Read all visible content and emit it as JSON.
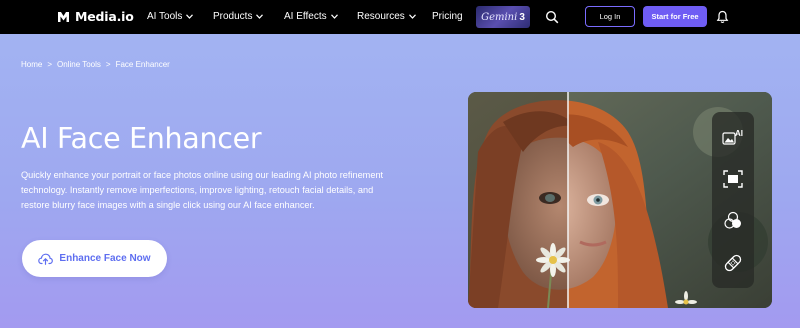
{
  "nav": {
    "brand": "Media.io",
    "items": [
      {
        "label": "AI Tools",
        "has_chevron": true
      },
      {
        "label": "Products",
        "has_chevron": true
      },
      {
        "label": "AI Effects",
        "has_chevron": true
      },
      {
        "label": "Resources",
        "has_chevron": true
      },
      {
        "label": "Pricing",
        "has_chevron": false
      }
    ],
    "promo": {
      "word": "Gemini",
      "number": "3"
    },
    "login_label": "Log In",
    "start_label": "Start for Free",
    "icons": [
      "search-icon",
      "bell-icon",
      "chevron-down-icon"
    ]
  },
  "breadcrumb": {
    "items": [
      "Home",
      "Online Tools",
      "Face Enhancer"
    ],
    "separator": ">"
  },
  "hero": {
    "title": "AI Face Enhancer",
    "description": "Quickly enhance your portrait or face photos online using our leading AI photo refinement technology. Instantly remove imperfections, improve lighting, retouch facial details, and restore blurry face images with a single click using our AI face enhancer.",
    "cta_label": "Enhance Face Now",
    "cta_icon": "upload-cloud-icon"
  },
  "image_toolbar": {
    "icons": [
      "ai-image-icon",
      "crop-frame-icon",
      "color-circles-icon",
      "bandage-icon"
    ],
    "ai_badge": "AI"
  },
  "colors": {
    "nav_bg": "#000000",
    "accent": "#6f5df4",
    "hero_bg": "#9ea8f0",
    "cta_text": "#5e6ef0"
  }
}
